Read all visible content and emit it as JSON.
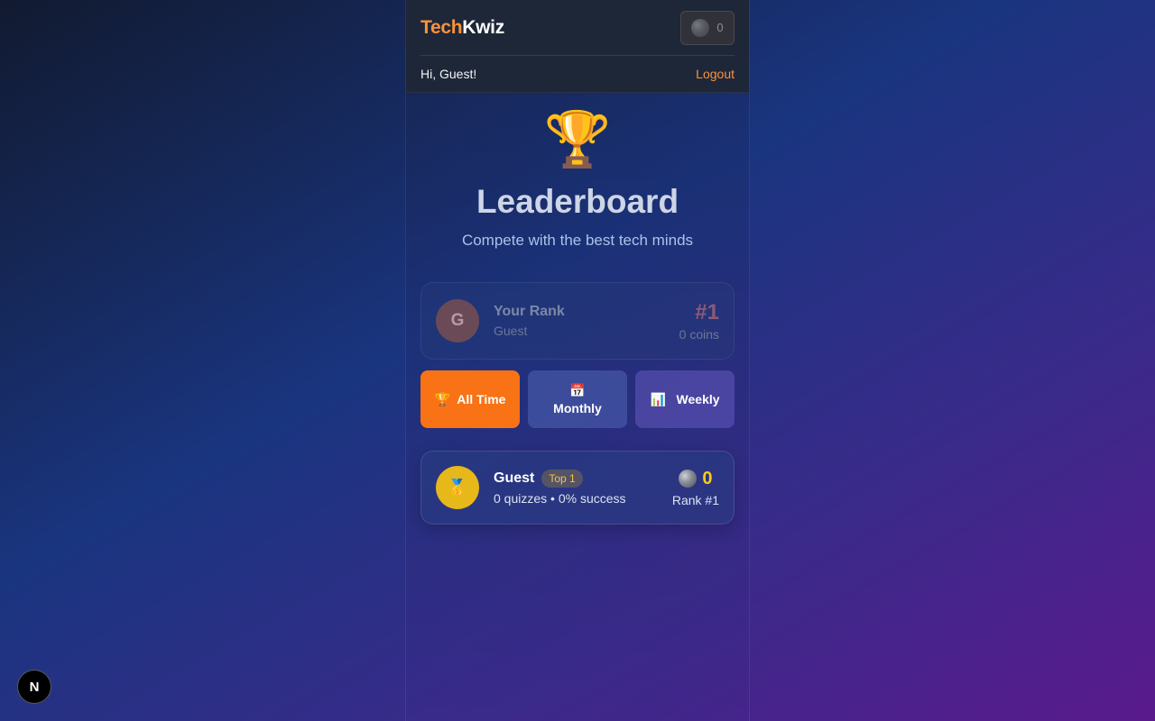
{
  "header": {
    "brand_part1": "Tech",
    "brand_part2": "Kwiz",
    "coins": "0",
    "greeting": "Hi, Guest!",
    "logout_label": "Logout"
  },
  "hero": {
    "icon": "🏆",
    "title": "Leaderboard",
    "subtitle": "Compete with the best tech minds"
  },
  "your_rank": {
    "avatar_letter": "G",
    "label": "Your Rank",
    "name": "Guest",
    "rank": "#1",
    "coins": "0 coins"
  },
  "tabs": [
    {
      "icon": "🏆",
      "label": "All Time",
      "active": true
    },
    {
      "icon": "📅",
      "label": "Monthly",
      "active": false
    },
    {
      "icon": "📊",
      "label": "Weekly",
      "active": false
    }
  ],
  "entries": [
    {
      "medal": "🥇",
      "name": "Guest",
      "badge": "Top 1",
      "stats": "0 quizzes • 0% success",
      "coins": "0",
      "rank": "Rank #1"
    }
  ],
  "dev_badge": "N",
  "colors": {
    "accent": "#f97316",
    "coin_yellow": "#facc15",
    "medal_gold": "#e6b81a",
    "header_bg": "#1e2738"
  }
}
